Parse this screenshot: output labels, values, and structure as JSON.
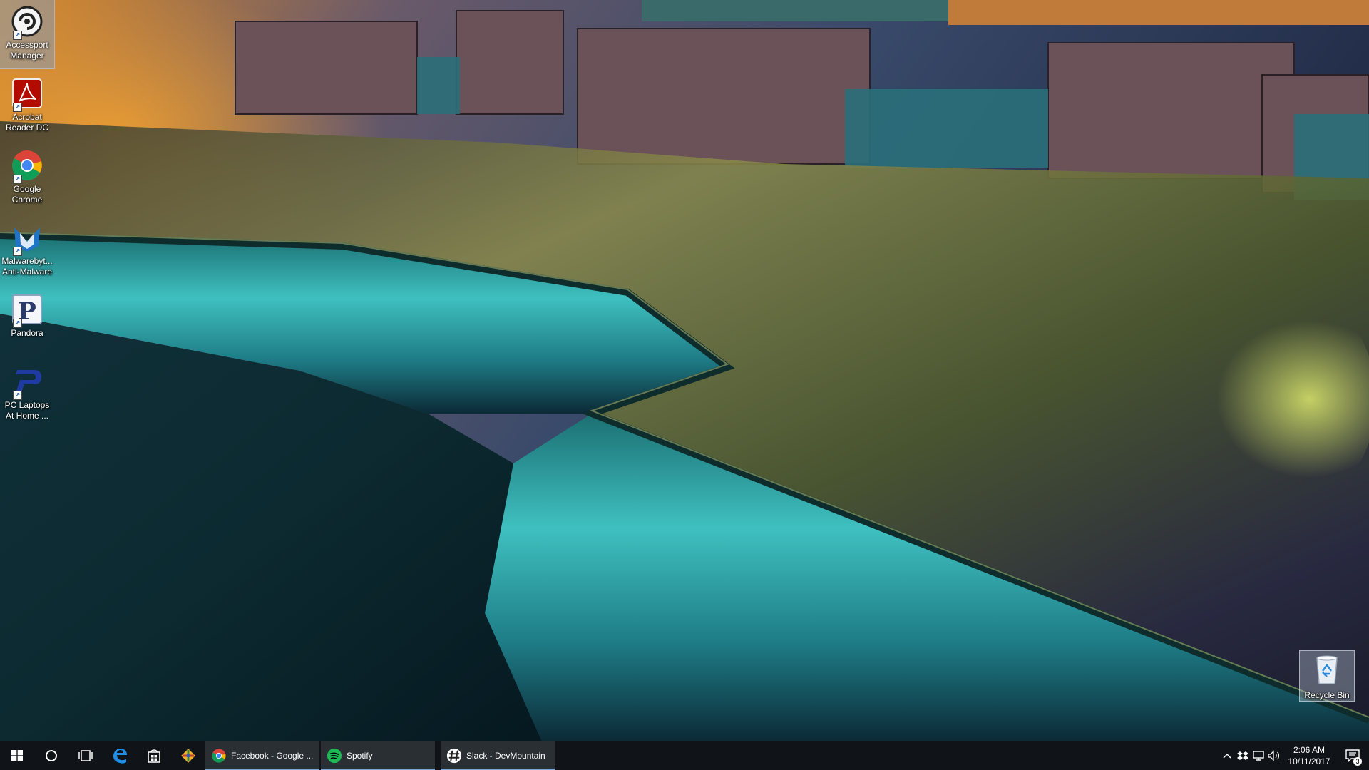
{
  "desktop": {
    "icons": [
      {
        "label": "Accessport\nManager",
        "icon": "accessport-icon"
      },
      {
        "label": "Acrobat\nReader DC",
        "icon": "acrobat-icon"
      },
      {
        "label": "Google\nChrome",
        "icon": "chrome-icon"
      },
      {
        "label": "Malwarebyt...\nAnti-Malware",
        "icon": "malwarebytes-icon"
      },
      {
        "label": "Pandora",
        "icon": "pandora-icon"
      },
      {
        "label": "PC Laptops\nAt Home ...",
        "icon": "pc-laptops-icon"
      }
    ],
    "recycle_bin": {
      "label": "Recycle Bin",
      "icon": "recycle-bin-icon"
    }
  },
  "taskbar": {
    "start": "windows-start-icon",
    "search": "cortana-search-icon",
    "task_view": "task-view-icon",
    "pinned": [
      "edge-icon",
      "store-icon",
      "git-icon"
    ],
    "apps": [
      {
        "label": "Facebook - Google ...",
        "icon": "chrome-icon"
      },
      {
        "label": "Spotify",
        "icon": "spotify-icon"
      },
      {
        "label": "Slack - DevMountain",
        "icon": "slack-icon"
      }
    ],
    "tray": {
      "time": "2:06 AM",
      "date": "10/11/2017",
      "notification_count": "3"
    }
  },
  "colors": {
    "taskbar_bg": "#101418",
    "active_underline": "#7aa7d8",
    "water_teal": "#2fb3b8"
  }
}
